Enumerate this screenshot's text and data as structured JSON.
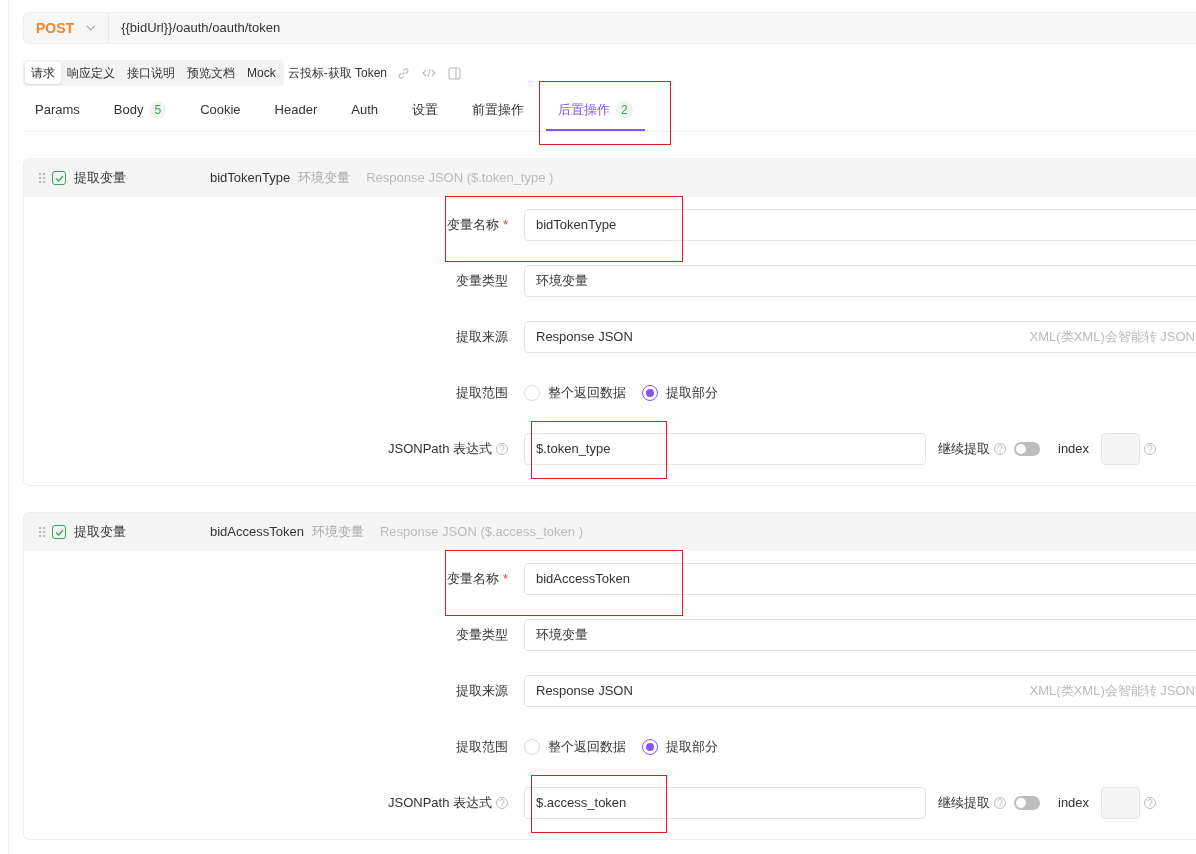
{
  "request": {
    "method": "POST",
    "url": "{{bidUrl}}/oauth/oauth/token"
  },
  "view_tabs": [
    {
      "label": "请求",
      "selected": true
    },
    {
      "label": "响应定义",
      "selected": false
    },
    {
      "label": "接口说明",
      "selected": false
    },
    {
      "label": "预览文档",
      "selected": false
    },
    {
      "label": "Mock",
      "selected": false
    }
  ],
  "api_name": "云投标-获取 Token",
  "tabs": [
    {
      "label": "Params",
      "selected": false,
      "highlight": false
    },
    {
      "label": "Body",
      "count": "5",
      "selected": false,
      "highlight": false
    },
    {
      "label": "Cookie",
      "selected": false,
      "highlight": false
    },
    {
      "label": "Header",
      "selected": false,
      "highlight": false
    },
    {
      "label": "Auth",
      "selected": false,
      "highlight": false
    },
    {
      "label": "设置",
      "selected": false,
      "highlight": false
    },
    {
      "label": "前置操作",
      "selected": false,
      "highlight": false
    },
    {
      "label": "后置操作",
      "count": "2",
      "selected": true,
      "highlight": true
    }
  ],
  "operations": [
    {
      "title": "提取变量",
      "enabled": true,
      "summary_name": "bidTokenType",
      "summary_type": "环境变量",
      "summary_source": "Response JSON ($.token_type )",
      "fields": [
        {
          "kind": "text",
          "label": "变量名称",
          "required_mark": "*",
          "value": "bidTokenType",
          "highlight": true
        },
        {
          "kind": "select",
          "label": "变量类型",
          "value": "环境变量",
          "highlight": false
        },
        {
          "kind": "select",
          "label": "提取来源",
          "value": "Response JSON",
          "hint": "XML(类XML)会智能转 JSON",
          "highlight": false
        },
        {
          "kind": "radio",
          "label": "提取范围",
          "options": [
            {
              "label": "整个返回数据",
              "selected": false
            },
            {
              "label": "提取部分",
              "selected": true
            }
          ],
          "highlight": false
        },
        {
          "kind": "jsonpath",
          "label": "JSONPath 表达式",
          "value": "$.token_type",
          "continue_label": "继续提取",
          "continue_on": false,
          "index_label": "index",
          "highlight": true
        }
      ]
    },
    {
      "title": "提取变量",
      "enabled": true,
      "summary_name": "bidAccessToken",
      "summary_type": "环境变量",
      "summary_source": "Response JSON ($.access_token )",
      "fields": [
        {
          "kind": "text",
          "label": "变量名称",
          "required_mark": "*",
          "value": "bidAccessToken",
          "highlight": true
        },
        {
          "kind": "select",
          "label": "变量类型",
          "value": "环境变量",
          "highlight": false
        },
        {
          "kind": "select",
          "label": "提取来源",
          "value": "Response JSON",
          "hint": "XML(类XML)会智能转 JSON",
          "highlight": false
        },
        {
          "kind": "radio",
          "label": "提取范围",
          "options": [
            {
              "label": "整个返回数据",
              "selected": false
            },
            {
              "label": "提取部分",
              "selected": true
            }
          ],
          "highlight": false
        },
        {
          "kind": "jsonpath",
          "label": "JSONPath 表达式",
          "value": "$.access_token",
          "continue_label": "继续提取",
          "continue_on": false,
          "index_label": "index",
          "highlight": true
        }
      ]
    }
  ]
}
